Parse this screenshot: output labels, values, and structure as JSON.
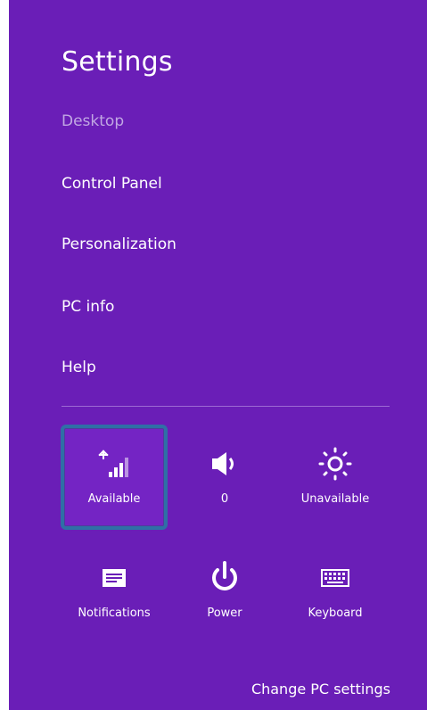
{
  "panel": {
    "title": "Settings",
    "context": "Desktop",
    "background": "#6a1eb7",
    "accent_border": "#2f6fa6"
  },
  "menu": [
    {
      "label": "Control Panel"
    },
    {
      "label": "Personalization"
    },
    {
      "label": "PC info"
    },
    {
      "label": "Help"
    }
  ],
  "quick_settings": [
    {
      "label": "Available",
      "icon": "network-signal-icon",
      "selected": true
    },
    {
      "label": "0",
      "icon": "volume-icon",
      "selected": false
    },
    {
      "label": "Unavailable",
      "icon": "brightness-icon",
      "selected": false
    },
    {
      "label": "Notifications",
      "icon": "notifications-icon",
      "selected": false
    },
    {
      "label": "Power",
      "icon": "power-icon",
      "selected": false
    },
    {
      "label": "Keyboard",
      "icon": "keyboard-icon",
      "selected": false
    }
  ],
  "footer": {
    "change_settings_label": "Change PC settings"
  }
}
